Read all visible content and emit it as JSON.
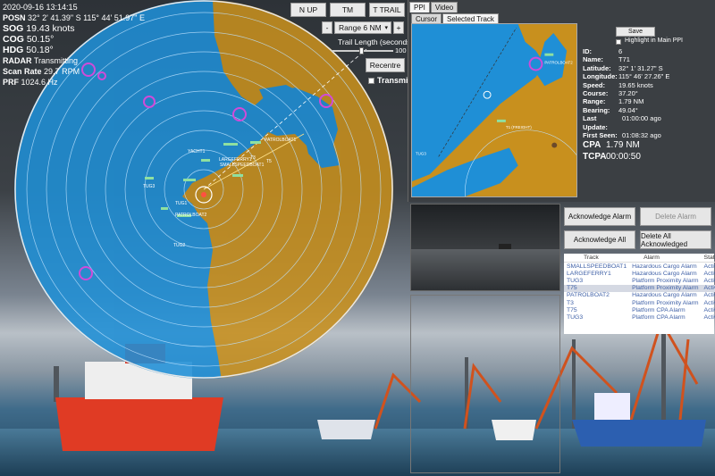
{
  "hud": {
    "datetime": "2020-09-16 13:14:15",
    "posn_label": "POSN",
    "posn_value": "32° 2' 41.39\" S   115° 44' 51.97\" E",
    "sog_label": "SOG",
    "sog_value": "19.43 knots",
    "cog_label": "COG",
    "cog_value": "50.15°",
    "hdg_label": "HDG",
    "hdg_value": "50.18°",
    "radar_label": "RADAR",
    "radar_value": "Transmitting",
    "scan_label": "Scan Rate",
    "scan_value": "29.7 RPM",
    "prf_label": "PRF",
    "prf_value": "1024.6 Hz"
  },
  "controls": {
    "n_up": "N UP",
    "tm": "TM",
    "t_trail": "T TRAIL",
    "minus": "-",
    "plus": "+",
    "range": "Range 6 NM",
    "trail_length_label": "Trail Length (seconds):",
    "trail_value": "100",
    "recentre": "Recentre",
    "transmit": "Transmit"
  },
  "radar_targets": [
    {
      "name": "SMALLSPEEDBOAT1"
    },
    {
      "name": "YACHT1"
    },
    {
      "name": "PATROLBOAT1"
    },
    {
      "name": "PATROLBOAT2"
    },
    {
      "name": "TUG3"
    },
    {
      "name": "TUG1"
    },
    {
      "name": "T5"
    },
    {
      "name": "T3"
    },
    {
      "name": "LARGEFERRY1"
    },
    {
      "name": "TUG2"
    }
  ],
  "right_panel": {
    "tabs": [
      "PPI",
      "Video"
    ],
    "subtabs": [
      "Cursor",
      "Selected Track"
    ],
    "save": "Save",
    "highlight": "Highlight in Main PPI",
    "mini_labels": [
      "PATROLBOAT2",
      "T1 (FREIGHT)",
      "TUG3"
    ],
    "track": {
      "id_label": "ID:",
      "id": "6",
      "name_label": "Name:",
      "name": "T71",
      "lat_label": "Latitude:",
      "lat": "32° 1' 31.27\" S",
      "lon_label": "Longitude:",
      "lon": "115° 46' 27.26\" E",
      "speed_label": "Speed:",
      "speed": "19.65 knots",
      "course_label": "Course:",
      "course": "37.20°",
      "range_label": "Range:",
      "range": "1.79 NM",
      "bearing_label": "Bearing:",
      "bearing": "49.04°",
      "last_label": "Last Update:",
      "last": "01:00:00 ago",
      "first_label": "First Seen:",
      "first": "01:08:32 ago",
      "cpa_label": "CPA",
      "cpa": "1.79 NM",
      "tcpa_label": "TCPA",
      "tcpa": "00:00:50"
    },
    "ack_alarm": "Acknowledge Alarm",
    "delete_alarm": "Delete Alarm",
    "ack_all": "Acknowledge All",
    "delete_all_ack": "Delete All Acknowledged",
    "alarm_headers": [
      "Track",
      "Alarm",
      "State"
    ],
    "alarms": [
      {
        "track": "SMALLSPEEDBOAT1",
        "alarm": "Hazardous Cargo Alarm",
        "state": "Active"
      },
      {
        "track": "LARGEFERRY1",
        "alarm": "Hazardous Cargo Alarm",
        "state": "Active"
      },
      {
        "track": "TUG3",
        "alarm": "Platform Proximity Alarm",
        "state": "Active"
      },
      {
        "track": "T75",
        "alarm": "Platform Proximity Alarm",
        "state": "Active"
      },
      {
        "track": "PATROLBOAT2",
        "alarm": "Hazardous Cargo Alarm",
        "state": "Active"
      },
      {
        "track": "T3",
        "alarm": "Platform Proximity Alarm",
        "state": "Active"
      },
      {
        "track": "T75",
        "alarm": "Platform CPA Alarm",
        "state": "Active"
      },
      {
        "track": "TUG3",
        "alarm": "Platform CPA Alarm",
        "state": "Active"
      }
    ],
    "selected_alarm_index": 3
  },
  "colors": {
    "sea": "#1f8fd6",
    "land": "#c8901e",
    "ring": "#bfe3ff",
    "accent": "#8fd8c6"
  }
}
